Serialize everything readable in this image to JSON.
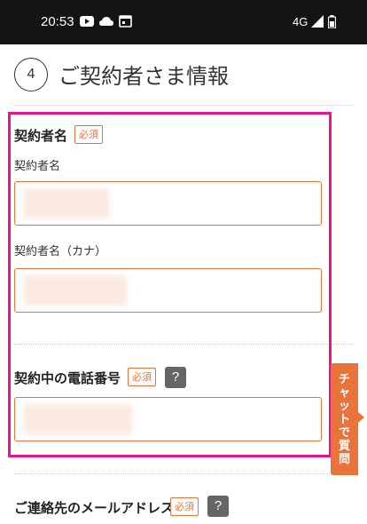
{
  "status_bar": {
    "time": "20:53",
    "network": "4G",
    "icons": [
      "youtube-icon",
      "cloud-icon",
      "calendar-icon",
      "signal-icon",
      "battery-icon"
    ]
  },
  "section": {
    "step_number": "4",
    "title": "ご契約者さま情報"
  },
  "form": {
    "contractor_name": {
      "title": "契約者名",
      "required_badge": "必須",
      "name_label": "契約者名",
      "kana_label": "契約者名（カナ）"
    },
    "phone": {
      "title": "契約中の電話番号",
      "required_badge": "必須",
      "help": "?"
    },
    "email": {
      "title": "ご連絡先のメールアドレス",
      "required_badge": "必須",
      "help": "?"
    }
  },
  "chat_tab": {
    "chars": [
      "チ",
      "ャ",
      "ッ",
      "ト",
      "で",
      "質",
      "問"
    ]
  },
  "colors": {
    "accent": "#e8743b",
    "highlight": "#e6158c",
    "help_bg": "#666666"
  }
}
